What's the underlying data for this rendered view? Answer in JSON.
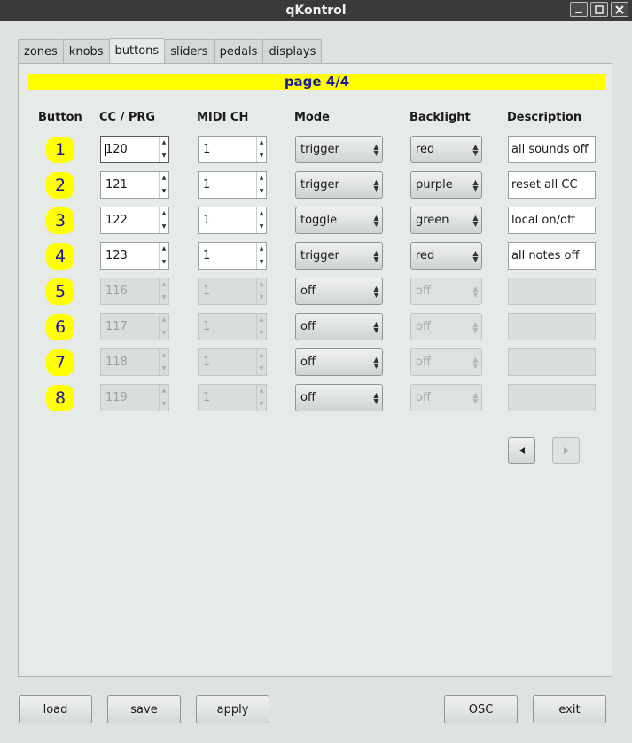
{
  "window": {
    "title": "qKontrol"
  },
  "tabs": [
    {
      "label": "zones"
    },
    {
      "label": "knobs"
    },
    {
      "label": "buttons"
    },
    {
      "label": "sliders"
    },
    {
      "label": "pedals"
    },
    {
      "label": "displays"
    }
  ],
  "page_indicator": "page 4/4",
  "headers": {
    "button": "Button",
    "cc_prg": "CC / PRG",
    "midi_ch": "MIDI CH",
    "mode": "Mode",
    "backlight": "Backlight",
    "description": "Description"
  },
  "rows": [
    {
      "number": "1",
      "cc": "120",
      "midi": "1",
      "mode": "trigger",
      "backlight": "red",
      "description": "all sounds off",
      "enabled": true
    },
    {
      "number": "2",
      "cc": "121",
      "midi": "1",
      "mode": "trigger",
      "backlight": "purple",
      "description": "reset all CC",
      "enabled": true
    },
    {
      "number": "3",
      "cc": "122",
      "midi": "1",
      "mode": "toggle",
      "backlight": "green",
      "description": "local on/off",
      "enabled": true
    },
    {
      "number": "4",
      "cc": "123",
      "midi": "1",
      "mode": "trigger",
      "backlight": "red",
      "description": "all notes off",
      "enabled": true
    },
    {
      "number": "5",
      "cc": "116",
      "midi": "1",
      "mode": "off",
      "backlight": "off",
      "description": "",
      "enabled": false
    },
    {
      "number": "6",
      "cc": "117",
      "midi": "1",
      "mode": "off",
      "backlight": "off",
      "description": "",
      "enabled": false
    },
    {
      "number": "7",
      "cc": "118",
      "midi": "1",
      "mode": "off",
      "backlight": "off",
      "description": "",
      "enabled": false
    },
    {
      "number": "8",
      "cc": "119",
      "midi": "1",
      "mode": "off",
      "backlight": "off",
      "description": "",
      "enabled": false
    }
  ],
  "nav": {
    "prev_icon": "triangle-left-icon",
    "next_icon": "triangle-right-icon",
    "next_enabled": false
  },
  "footer": {
    "load": "load",
    "save": "save",
    "apply": "apply",
    "osc": "OSC",
    "exit": "exit"
  },
  "colors": {
    "page_bar": "#ffff00",
    "page_text": "#1a1a9c",
    "button_badge": "#ffff00"
  }
}
